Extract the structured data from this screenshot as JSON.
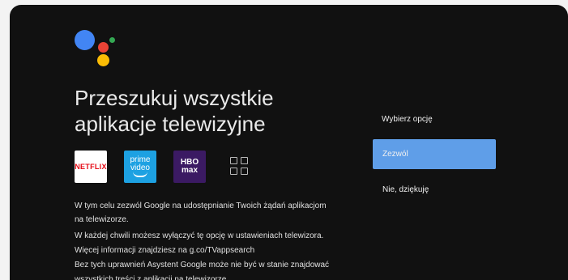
{
  "assistant": {
    "logo_colors": [
      "#4285F4",
      "#EA4335",
      "#FBBC05",
      "#34A853"
    ]
  },
  "heading": {
    "line1": "Przeszukuj wszystkie",
    "line2": "aplikacje telewizyjne"
  },
  "apps": {
    "netflix": "NETFLIX",
    "prime_line1": "prime",
    "prime_line2": "video",
    "hbo_line1": "HBO",
    "hbo_line2": "max",
    "more_icon": "grid-icon"
  },
  "description": [
    "W tym celu zezwól Google na udostępnianie Twoich żądań aplikacjom",
    "na telewizorze.",
    "W każdej chwili możesz wyłączyć tę opcję w ustawieniach telewizora.",
    "Więcej informacji znajdziesz na g.co/TVappsearch",
    "Bez tych uprawnień Asystent Google może nie być w stanie znajdować",
    "wszystkich treści z aplikacji na telewizorze."
  ],
  "panel": {
    "label": "Wybierz opcję",
    "allow": "Zezwól",
    "decline": "Nie, dziękuję"
  },
  "colors": {
    "background": "#111111",
    "selected_option": "#5f9ee8"
  }
}
